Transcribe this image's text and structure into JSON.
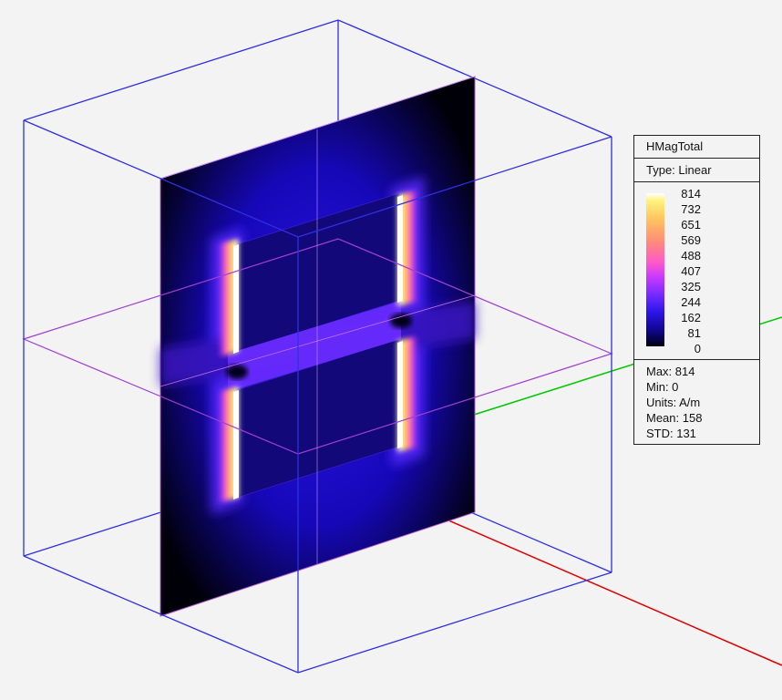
{
  "legend": {
    "title": "HMagTotal",
    "type": "Type: Linear",
    "ticks": [
      "814",
      "732",
      "651",
      "569",
      "488",
      "407",
      "325",
      "244",
      "162",
      "81",
      "0"
    ],
    "stats": {
      "max": "Max: 814",
      "min": "Min: 0",
      "units": "Units: A/m",
      "mean": "Mean: 158",
      "std": "STD: 131"
    }
  },
  "colors": {
    "background": "#f3f3f3",
    "bounding_box": "#2f2fe0",
    "axis_x": "#e00000",
    "axis_y": "#00c800",
    "cut_plane_outline": "#a040d0",
    "field_low": "#000010",
    "field_mid": "#2a14e8",
    "field_high": "#ffffff"
  },
  "icons": [
    "field-plot",
    "color-scale-legend",
    "coordinate-axes"
  ]
}
